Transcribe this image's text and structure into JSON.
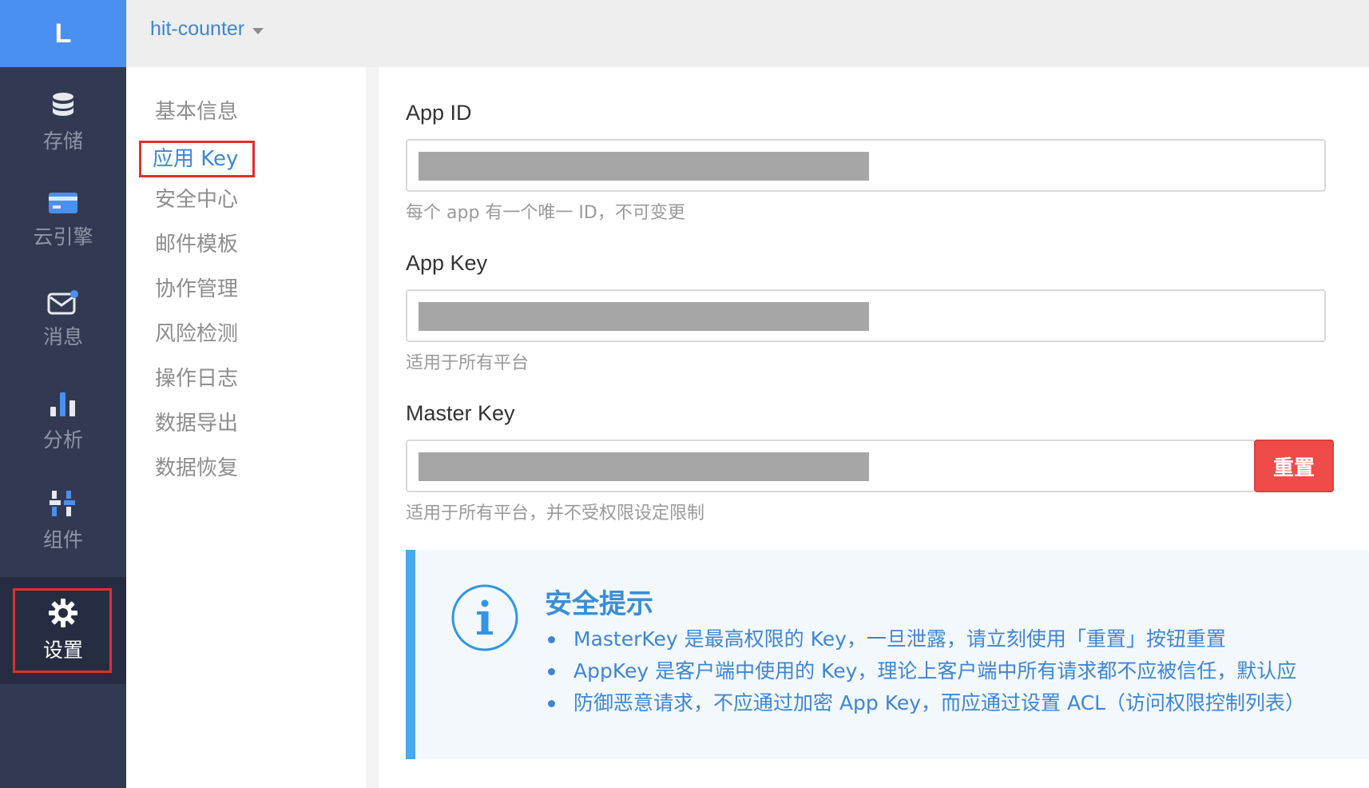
{
  "brand": {
    "logo_letter": "L"
  },
  "rail": {
    "items": [
      {
        "label": "存储",
        "icon": "database-icon"
      },
      {
        "label": "云引擎",
        "icon": "card-icon"
      },
      {
        "label": "消息",
        "icon": "message-icon"
      },
      {
        "label": "分析",
        "icon": "bar-chart-icon"
      },
      {
        "label": "组件",
        "icon": "components-icon"
      },
      {
        "label": "设置",
        "icon": "gear-icon",
        "active": true
      }
    ]
  },
  "topbar": {
    "app_name": "hit-counter"
  },
  "subnav": {
    "items": [
      {
        "label": "基本信息"
      },
      {
        "label": "应用 Key",
        "active": true
      },
      {
        "label": "安全中心"
      },
      {
        "label": "邮件模板"
      },
      {
        "label": "协作管理"
      },
      {
        "label": "风险检测"
      },
      {
        "label": "操作日志"
      },
      {
        "label": "数据导出"
      },
      {
        "label": "数据恢复"
      }
    ]
  },
  "fields": {
    "app_id": {
      "label": "App ID",
      "hint": "每个 app 有一个唯一 ID，不可变更"
    },
    "app_key": {
      "label": "App Key",
      "hint": "适用于所有平台"
    },
    "master_key": {
      "label": "Master Key",
      "hint": "适用于所有平台，并不受权限设定限制",
      "reset_label": "重置"
    }
  },
  "security_tip": {
    "title": "安全提示",
    "items": [
      "MasterKey 是最高权限的 Key，一旦泄露，请立刻使用「重置」按钮重置",
      "AppKey 是客户端中使用的 Key，理论上客户端中所有请求都不应被信任，默认应",
      "防御恶意请求，不应通过加密 App Key，而应通过设置 ACL（访问权限控制列表）"
    ]
  },
  "colors": {
    "rail_bg": "#323a53",
    "brand_blue": "#4a90f0",
    "link_blue": "#3d86d6",
    "danger": "#ef4b49",
    "highlight_red": "#e0302a"
  }
}
